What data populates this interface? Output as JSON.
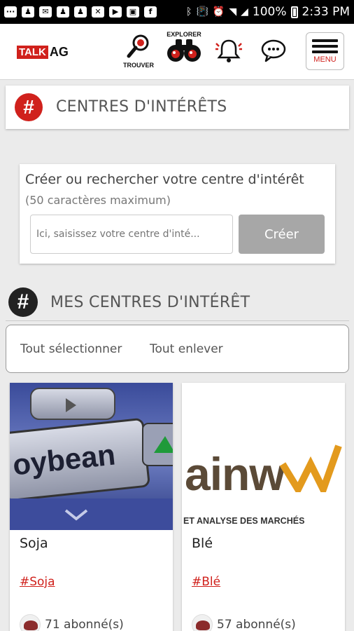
{
  "status_bar": {
    "battery": "100%",
    "time": "2:33 PM"
  },
  "header": {
    "logo_talk": "TALK",
    "logo_ag": "AG",
    "nav_trouver": "TROUVER",
    "nav_explorer": "EXPLORER",
    "menu_label": "MENU"
  },
  "interests_section": {
    "title": "CENTRES D'INTÉRÊTS"
  },
  "create_box": {
    "title": "Créer ou rechercher votre centre d'intérêt",
    "subtitle": "(50 caractères maximum)",
    "input_placeholder": "Ici, saisissez votre centre d'inté...",
    "button_label": "Créer"
  },
  "my_interests": {
    "title": "MES CENTRES D'INTÉRÊT",
    "select_all": "Tout sélectionner",
    "remove_all": "Tout enlever"
  },
  "tiles": [
    {
      "name": "Soja",
      "tag": "#Soja",
      "subscribers": "71 abonné(s)",
      "image_text": "oybean"
    },
    {
      "name": "Blé",
      "tag": "#Blé",
      "subscribers": "57 abonné(s)",
      "image_text": "ainw",
      "image_caption": "ET ANALYSE DES MARCHÉS"
    }
  ],
  "colors": {
    "brand_red": "#d0211c",
    "button_gray": "#a7a7a7"
  }
}
